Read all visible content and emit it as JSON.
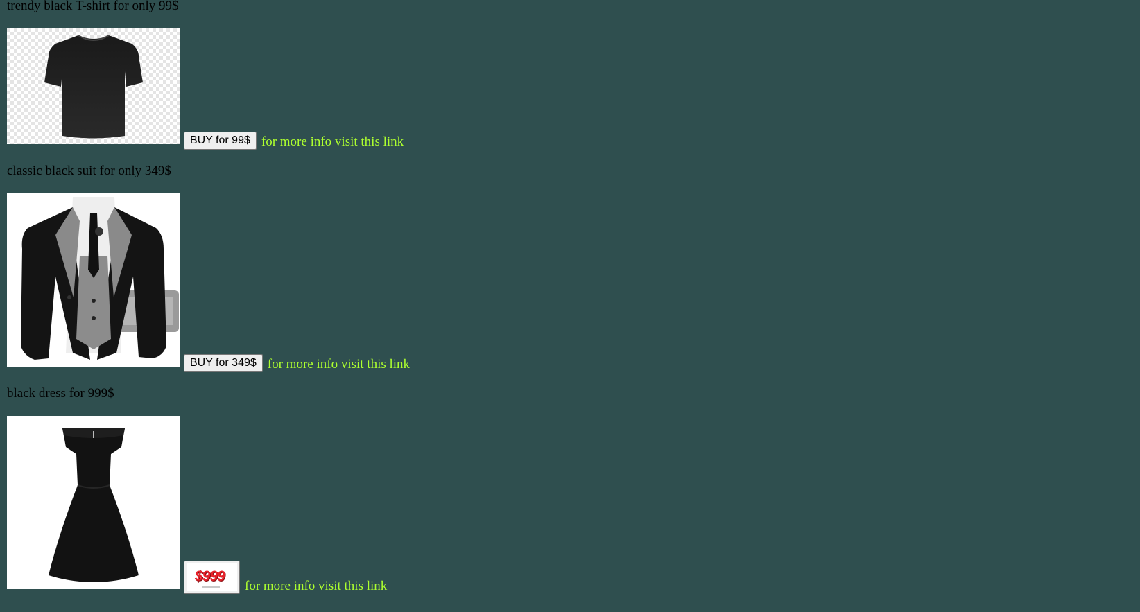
{
  "background_color": "#2f4f4f",
  "link_color": "#adff2f",
  "products": [
    {
      "title": "trendy black T-shirt for only 99$",
      "image": "black-tshirt-image",
      "buy_label": "BUY for 99$",
      "link_text": "for more info visit this link"
    },
    {
      "title": "classic black suit for only 349$",
      "image": "black-suit-image",
      "buy_label": "BUY for 349$",
      "link_text": "for more info visit this link"
    },
    {
      "title": "black dress for 999$",
      "image": "black-dress-image",
      "buy_image_text": "$999",
      "link_text": "for more info visit this link"
    }
  ]
}
